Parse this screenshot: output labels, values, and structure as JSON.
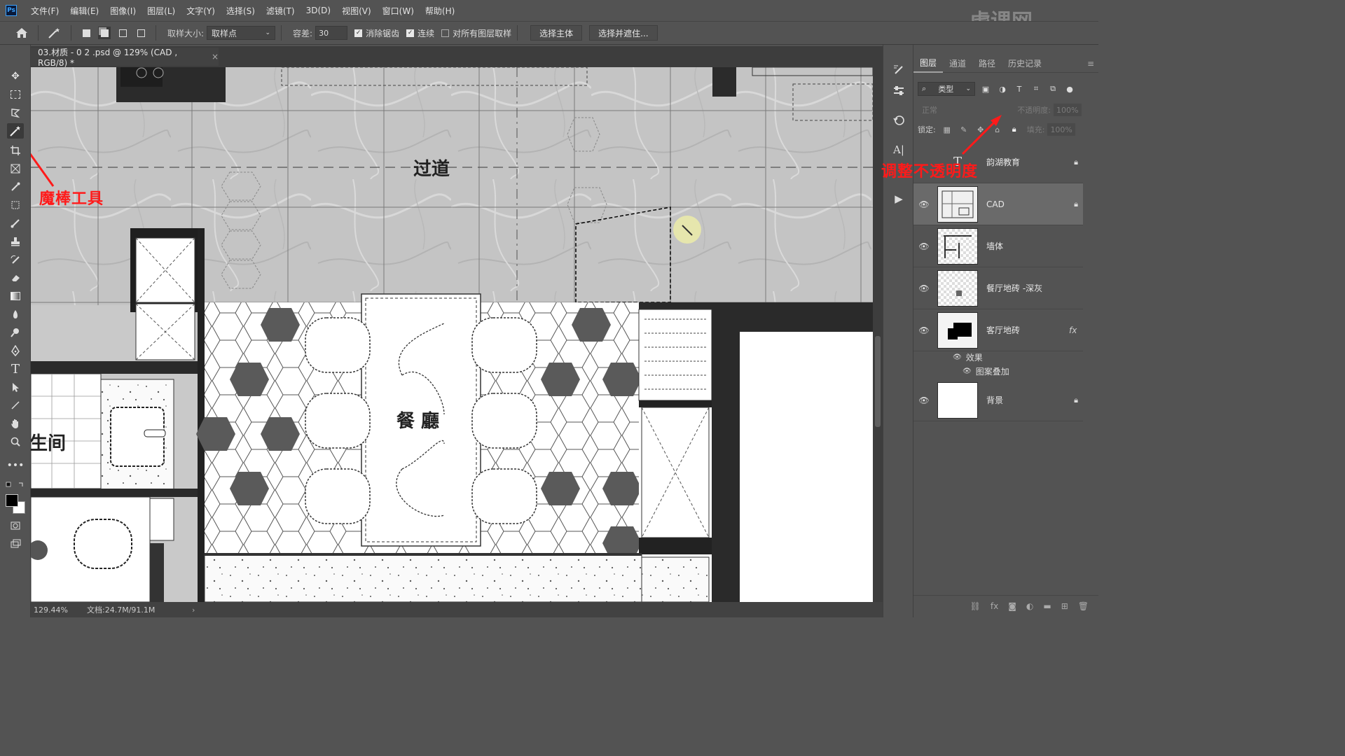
{
  "app": {
    "logo": "Ps",
    "menus": [
      "文件(F)",
      "编辑(E)",
      "图像(I)",
      "图层(L)",
      "文字(Y)",
      "选择(S)",
      "滤镜(T)",
      "3D(D)",
      "视图(V)",
      "窗口(W)",
      "帮助(H)"
    ],
    "watermark": "虎课网"
  },
  "options": {
    "sample_size_label": "取样大小:",
    "sample_size_value": "取样点",
    "tolerance_label": "容差:",
    "tolerance_value": "30",
    "anti_alias_label": "消除锯齿",
    "anti_alias_checked": true,
    "contiguous_label": "连续",
    "contiguous_checked": true,
    "sample_all_label": "对所有图层取样",
    "sample_all_checked": false,
    "select_subject_label": "选择主体",
    "select_mask_label": "选择并遮住..."
  },
  "document": {
    "tab_title": "03.材质 - 0 2 .psd @ 129% (CAD , RGB/8) *",
    "close": "×",
    "zoom": "129.44%",
    "doc_size": "文档:24.7M/91.1M",
    "labels": {
      "corridor": "过道",
      "dining": "餐   廳",
      "bathroom": "生间"
    }
  },
  "annotations": {
    "magic_wand": "魔棒工具",
    "opacity_hint": "调整不透明度"
  },
  "panel": {
    "tabs": [
      "图层",
      "通道",
      "路径",
      "历史记录"
    ],
    "active_tab": 0,
    "filter_type": "类型",
    "blend_mode": "正常",
    "opacity_label": "不透明度:",
    "opacity_value": "100%",
    "lock_label": "锁定:",
    "fill_label": "填充:",
    "fill_value": "100%",
    "layers": [
      {
        "name": "韵湖教育",
        "locked": true,
        "selected": false
      },
      {
        "name": "CAD",
        "locked": true,
        "selected": true
      },
      {
        "name": "墙体",
        "locked": false,
        "selected": false
      },
      {
        "name": "餐厅地砖 -深灰",
        "locked": false,
        "selected": false
      },
      {
        "name": "客厅地砖",
        "locked": false,
        "selected": false,
        "fx": "fx"
      },
      {
        "name": "背景",
        "locked": true,
        "selected": false
      }
    ],
    "effects_label": "效果",
    "effect_item": "图案叠加"
  },
  "colors": {
    "accent_red": "#ff1a1a",
    "ui_bg": "#535353",
    "selected_layer": "#6a6a6a"
  }
}
